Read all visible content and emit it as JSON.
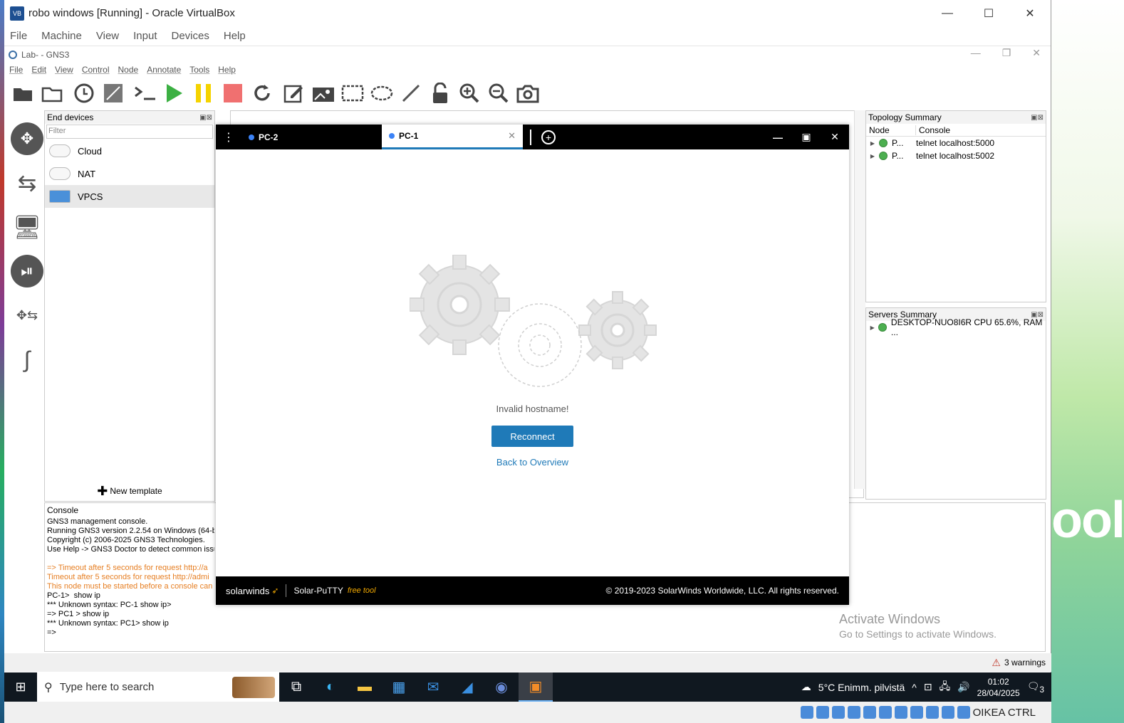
{
  "vbox": {
    "title": "robo windows [Running] - Oracle VirtualBox",
    "menu": [
      "File",
      "Machine",
      "View",
      "Input",
      "Devices",
      "Help"
    ],
    "controls": {
      "minimize": "—",
      "maximize": "☐",
      "close": "✕"
    }
  },
  "gns3": {
    "title": "Lab- - GNS3",
    "menu": [
      "File",
      "Edit",
      "View",
      "Control",
      "Node",
      "Annotate",
      "Tools",
      "Help"
    ],
    "end_devices": {
      "title": "End devices",
      "filter_placeholder": "Filter",
      "items": [
        "Cloud",
        "NAT",
        "VPCS"
      ],
      "new_template": "New template"
    },
    "console": {
      "title": "Console",
      "lines": [
        {
          "text": "GNS3 management console.",
          "color": "normal"
        },
        {
          "text": "Running GNS3 version 2.2.54 on Windows (64-b",
          "color": "normal"
        },
        {
          "text": "Copyright (c) 2006-2025 GNS3 Technologies.",
          "color": "normal"
        },
        {
          "text": "Use Help -> GNS3 Doctor to detect common issu",
          "color": "normal"
        },
        {
          "text": "",
          "color": "normal"
        },
        {
          "text": "=> Timeout after 5 seconds for request http://a",
          "color": "orange"
        },
        {
          "text": "Timeout after 5 seconds for request http://admi",
          "color": "orange"
        },
        {
          "text": "This node must be started before a console can",
          "color": "orange"
        },
        {
          "text": "PC-1>  show ip",
          "color": "normal"
        },
        {
          "text": "*** Unknown syntax: PC-1 show ip>",
          "color": "normal"
        },
        {
          "text": "=> PC1 > show ip",
          "color": "normal"
        },
        {
          "text": "*** Unknown syntax: PC1> show ip",
          "color": "normal"
        },
        {
          "text": "=>",
          "color": "normal"
        }
      ]
    },
    "topology": {
      "title": "Topology Summary",
      "columns": [
        "Node",
        "Console"
      ],
      "rows": [
        {
          "node": "P...",
          "console": "telnet localhost:5000"
        },
        {
          "node": "P...",
          "console": "telnet localhost:5002"
        }
      ]
    },
    "servers": {
      "title": "Servers Summary",
      "rows": [
        "DESKTOP-NUO8I6R CPU 65.6%, RAM ..."
      ]
    },
    "status": {
      "warnings": "3 warnings"
    }
  },
  "putty": {
    "tabs": [
      {
        "label": "PC-2",
        "active": false
      },
      {
        "label": "PC-1",
        "active": true
      }
    ],
    "message": "Invalid hostname!",
    "reconnect": "Reconnect",
    "back": "Back to Overview",
    "footer": {
      "brand": "solarwinds",
      "product": "Solar-PuTTY",
      "free": "free tool",
      "copyright": "© 2019-2023 SolarWinds Worldwide, LLC. All rights reserved."
    }
  },
  "activate": {
    "line1": "Activate Windows",
    "line2": "Go to Settings to activate Windows."
  },
  "taskbar": {
    "search_placeholder": "Type here to search",
    "weather": "5°C  Enimm. pilvistä",
    "time": "01:02",
    "date": "28/04/2025",
    "notif_count": "3"
  },
  "vbox_status": {
    "host_key": "OIKEA CTRL"
  },
  "desktop": {
    "text": "ool"
  }
}
